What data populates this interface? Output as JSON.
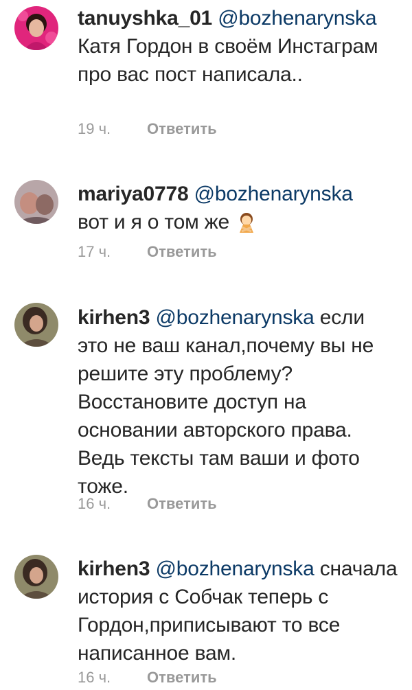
{
  "comments": [
    {
      "username": "tanuyshka_01",
      "mention": "@bozhenarynska",
      "text": "Катя Гордон в своём Инстаграм про вас пост написала..",
      "time": "19 ч.",
      "reply_label": "Ответить"
    },
    {
      "username": "mariya0778",
      "mention": "@bozhenarynska",
      "text": "вот и я о том же",
      "emoji": "woman-gesturing-no-emoji",
      "time": "17 ч.",
      "reply_label": "Ответить"
    },
    {
      "username": "kirhen3",
      "mention": "@bozhenarynska",
      "text": "если это не ваш канал,почему вы не решите эту проблему? Восстановите доступ на основании авторского права. Ведь тексты там ваши и фото тоже.",
      "time": "16 ч.",
      "reply_label": "Ответить"
    },
    {
      "username": "kirhen3",
      "mention": "@bozhenarynska",
      "text": "сначала история с Собчак теперь с Гордон,приписывают то все написанное вам.",
      "time": "16 ч.",
      "reply_label": "Ответить"
    }
  ],
  "colors": {
    "username": "#262626",
    "mention": "#0c3a66",
    "meta": "#999999"
  }
}
